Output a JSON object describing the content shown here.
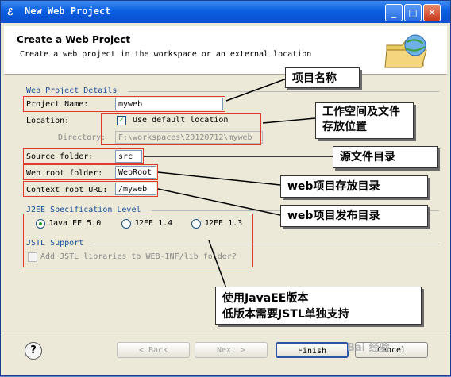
{
  "window": {
    "title": "New Web Project"
  },
  "header": {
    "title": "Create a Web Project",
    "description": "Create a web project in the workspace or an external location"
  },
  "details": {
    "group_label": "Web Project Details",
    "project_name_label": "Project Name:",
    "project_name_value": "myweb",
    "location_label": "Location:",
    "use_default_label": "Use default location",
    "directory_label": "Directory:",
    "directory_value": "F:\\workspaces\\20120712\\myweb",
    "source_folder_label": "Source folder:",
    "source_folder_value": "src",
    "web_root_label": "Web root folder:",
    "web_root_value": "WebRoot",
    "context_root_label": "Context root URL:",
    "context_root_value": "/myweb"
  },
  "j2ee": {
    "group_label": "J2EE Specification Level",
    "options": [
      "Java EE 5.0",
      "J2EE 1.4",
      "J2EE 1.3"
    ],
    "selected": "Java EE 5.0"
  },
  "jstl": {
    "group_label": "JSTL Support",
    "checkbox_label": "Add JSTL libraries to WEB-INF/lib folder?"
  },
  "callouts": {
    "project_name": "项目名称",
    "location": "工作空间及文件存放位置",
    "source_folder": "源文件目录",
    "web_root": "web项目存放目录",
    "context_root": "web项目发布目录",
    "j2ee_line1": "使用JavaEE版本",
    "j2ee_line2": "低版本需要JSTL单独支持"
  },
  "buttons": {
    "help": "?",
    "back": "< Back",
    "next": "Next >",
    "finish": "Finish",
    "cancel": "Cancel"
  },
  "watermark": "Bai 经验",
  "colors": {
    "callout_border": "#e0392d",
    "titlebar": "#0b5fe0",
    "group_label": "#1a4d9c"
  },
  "icons": {
    "app": "eclipse-icon",
    "header": "web-project-folder-icon"
  }
}
